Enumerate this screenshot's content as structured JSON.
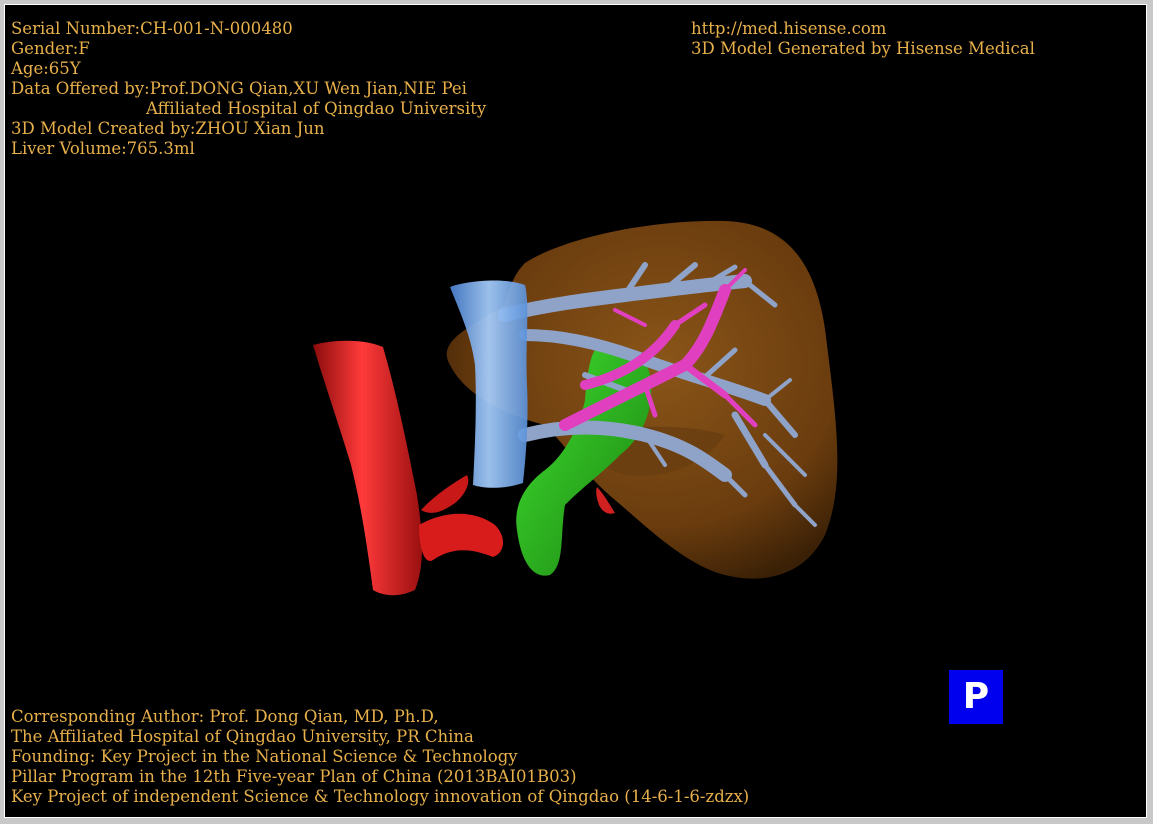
{
  "patient_info": {
    "serial": "Serial Number:CH-001-N-000480",
    "gender": "Gender:F",
    "age": "Age:65Y",
    "data_offered": "Data Offered by:Prof.DONG Qian,XU Wen Jian,NIE Pei",
    "hospital": "Affiliated Hospital of Qingdao University",
    "model_created": "3D Model Created by:ZHOU Xian Jun",
    "liver_volume": "Liver Volume:765.3ml"
  },
  "branding": {
    "url": "http://med.hisense.com",
    "generated_by": "3D Model Generated by Hisense Medical"
  },
  "credits": {
    "author": "Corresponding Author: Prof. Dong Qian, MD, Ph.D,",
    "affiliation": "The Affiliated Hospital of Qingdao University, PR China",
    "founding": "Founding: Key Project in the National Science & Technology",
    "program": "Pillar Program in the 12th Five-year Plan of China (2013BAI01B03)",
    "project": "Key Project of independent Science & Technology innovation of Qingdao (14-6-1-6-zdzx)"
  },
  "controls": {
    "p_button_label": "P"
  },
  "colors": {
    "background": "#000000",
    "text": "#e8b04a",
    "liver": "#7a4a14",
    "artery": "#e02020",
    "portal_vein": "#8fa3c8",
    "hepatic_vein": "#e040c0",
    "gallbladder": "#30c020",
    "vena_cava": "#6fa8e8",
    "p_button": "#0000ee"
  }
}
